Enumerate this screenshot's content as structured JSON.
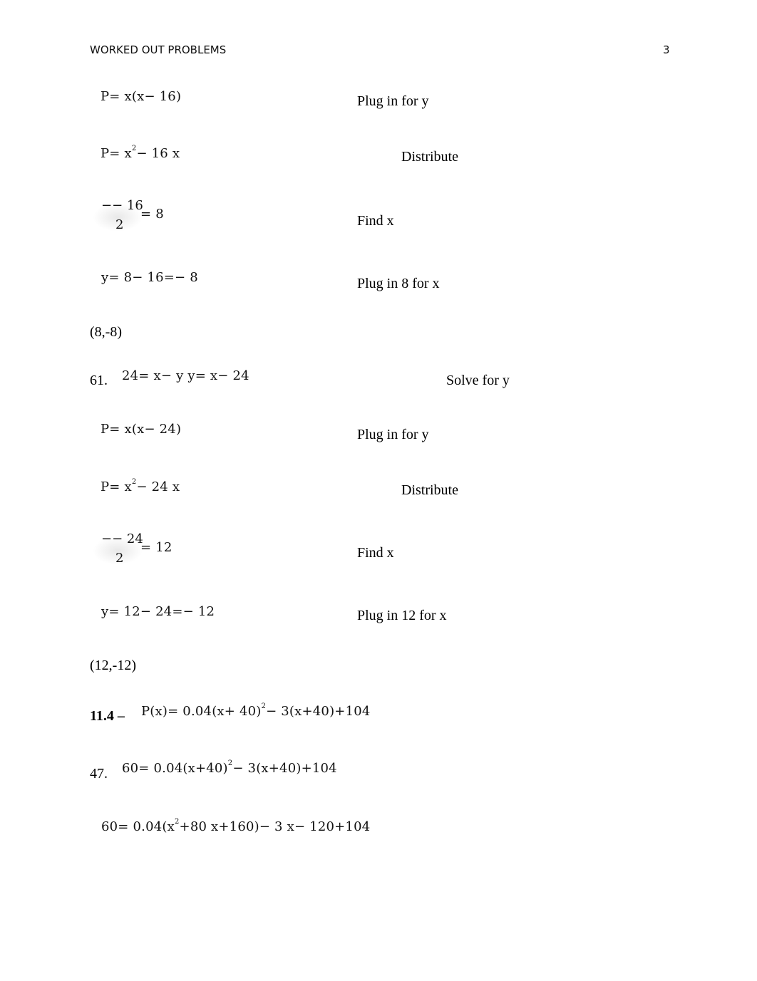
{
  "header": {
    "title": "WORKED OUT PROBLEMS",
    "page_number": "3"
  },
  "block1": {
    "steps": [
      {
        "math": "P= x(x− 16)",
        "note": "Plug in for y"
      },
      {
        "math_pre": "P= x",
        "math_sup": "2",
        "math_post": "− 16 x",
        "note": "Distribute"
      },
      {
        "frac_num": "−−  16",
        "frac_den": "2",
        "frac_rest": "= 8",
        "note": "Find x"
      },
      {
        "math": "y= 8− 16=−  8",
        "note": "Plug in 8 for x"
      }
    ],
    "result": "(8,-8)"
  },
  "problem61": {
    "number": "61.",
    "equation": "24= x−  y y= x− 24",
    "note": "Solve for y",
    "steps": [
      {
        "math": "P= x(x− 24)",
        "note": "Plug in for y"
      },
      {
        "math_pre": "P= x",
        "math_sup": "2",
        "math_post": "− 24 x",
        "note": "Distribute"
      },
      {
        "frac_num": "−−  24",
        "frac_den": "2",
        "frac_rest": "= 12",
        "note": "Find x"
      },
      {
        "math": "y= 12− 24=−  12",
        "note": "Plug in 12 for x"
      }
    ],
    "result": "(12,-12)"
  },
  "section114": {
    "label": "11.4 –",
    "math_pre": "P(x)= 0.04(x+ 40)",
    "math_sup": "2",
    "math_post": "− 3(x+40)+104"
  },
  "problem47": {
    "number": "47.",
    "line1_pre": "60= 0.04(x+40)",
    "line1_sup": "2",
    "line1_post": "− 3(x+40)+104",
    "line2_pre": "60= 0.04(x",
    "line2_sup": "2",
    "line2_post": "+80 x+160)− 3 x− 120+104"
  }
}
